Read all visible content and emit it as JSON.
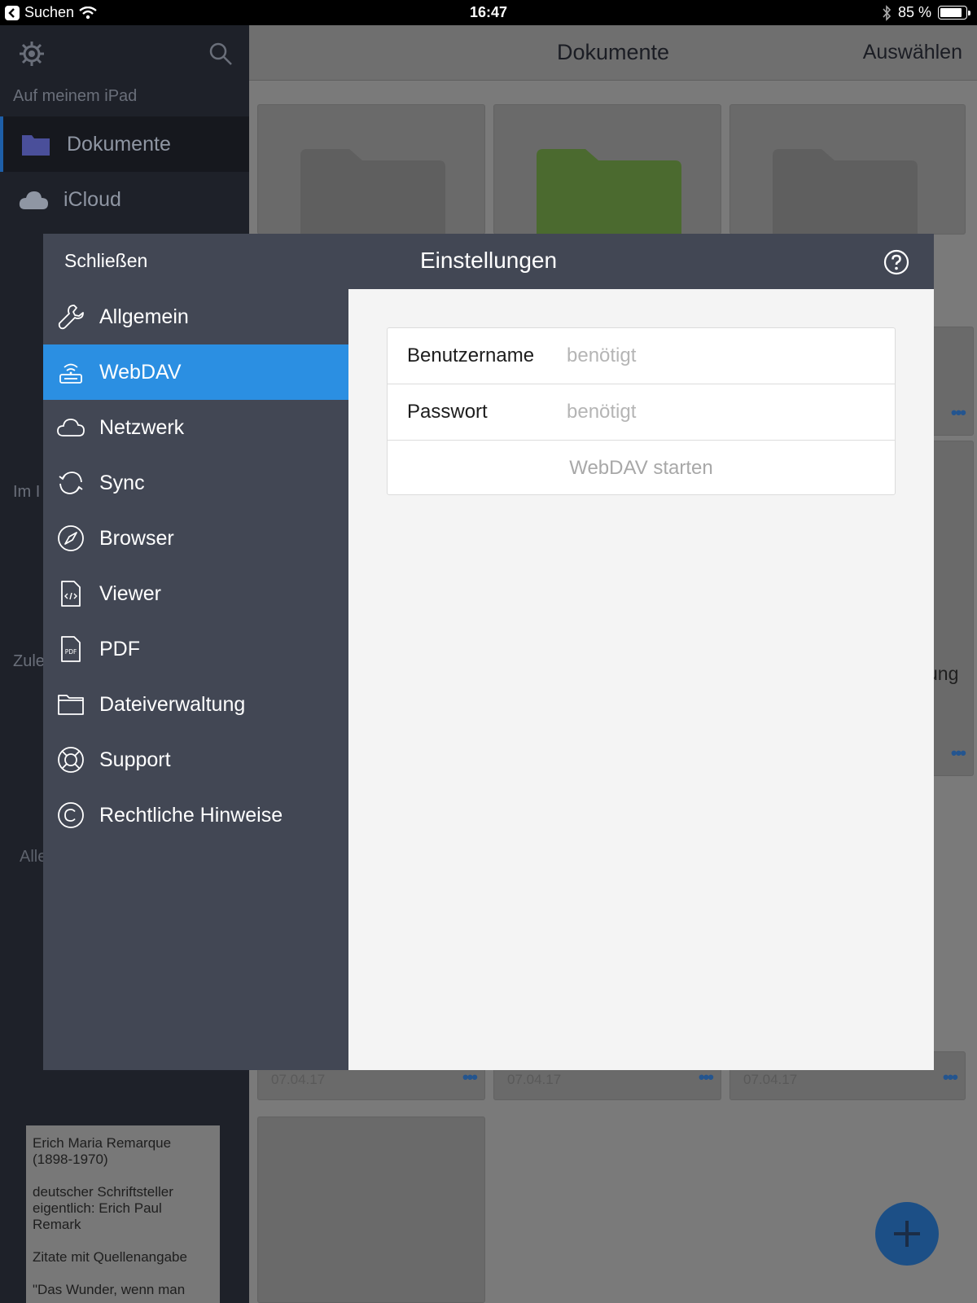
{
  "status_bar": {
    "back_app": "Suchen",
    "time": "16:47",
    "battery": "85 %",
    "battery_level": 0.85
  },
  "background": {
    "sidebar": {
      "section_local": "Auf meinem iPad",
      "items": [
        {
          "label": "Dokumente",
          "icon": "folder-icon"
        },
        {
          "label": "iCloud",
          "icon": "cloud-icon"
        }
      ],
      "partial_labels": [
        "Im I",
        "Zule",
        "Alle"
      ]
    },
    "nav": {
      "title": "Dokumente",
      "select_label": "Auswählen"
    },
    "tile_date": "07.04.17",
    "tile_partial_text": "ung",
    "note": {
      "lines": [
        "Erich Maria Remarque (1898-1970)",
        "deutscher Schriftsteller eigentlich: Erich Paul Remark",
        "Zitate mit Quellenangabe",
        "\"Das Wunder, wenn man"
      ]
    }
  },
  "modal": {
    "close_label": "Schließen",
    "title": "Einstellungen",
    "help_icon": "help-icon",
    "menu": [
      {
        "label": "Allgemein",
        "icon": "wrench-icon"
      },
      {
        "label": "WebDAV",
        "icon": "webdav-icon",
        "selected": true
      },
      {
        "label": "Netzwerk",
        "icon": "cloud-icon"
      },
      {
        "label": "Sync",
        "icon": "sync-icon"
      },
      {
        "label": "Browser",
        "icon": "compass-icon"
      },
      {
        "label": "Viewer",
        "icon": "code-file-icon"
      },
      {
        "label": "PDF",
        "icon": "pdf-file-icon"
      },
      {
        "label": "Dateiverwaltung",
        "icon": "folder-icon"
      },
      {
        "label": "Support",
        "icon": "lifebuoy-icon"
      },
      {
        "label": "Rechtliche Hinweise",
        "icon": "copyright-icon"
      }
    ],
    "form": {
      "username_label": "Benutzername",
      "username_placeholder": "benötigt",
      "password_label": "Passwort",
      "password_placeholder": "benötigt",
      "start_label": "WebDAV starten"
    }
  },
  "colors": {
    "accent": "#2b8fe2",
    "modal_bg": "#424754",
    "content_bg": "#f4f4f4",
    "fab": "#1c4f86"
  }
}
